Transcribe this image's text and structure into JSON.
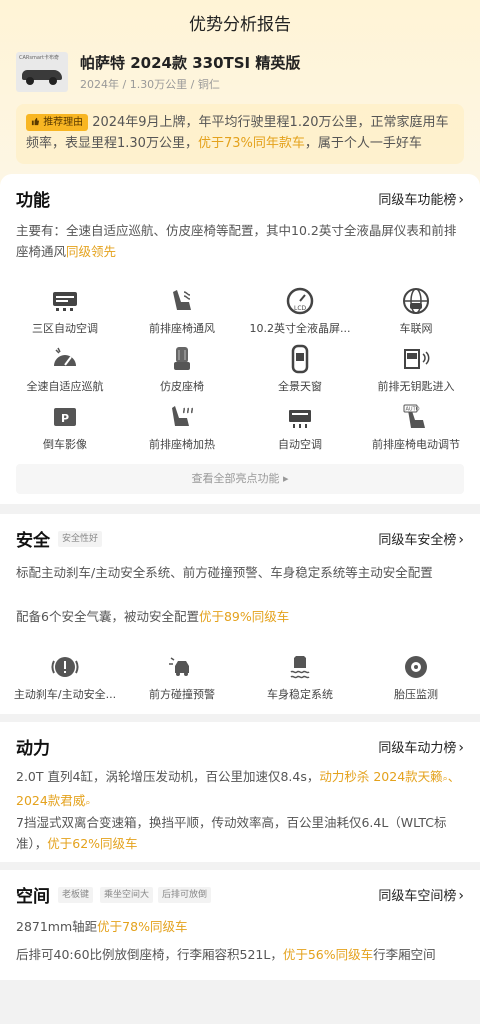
{
  "page": {
    "title": "优势分析报告"
  },
  "car": {
    "thumb_brand": "CARsmart卡布奇",
    "name": "帕萨特 2024款 330TSI 精英版",
    "meta": "2024年 / 1.30万公里 / 铜仁"
  },
  "reason": {
    "tag": "推荐理由",
    "text_a": "2024年9月上牌，年平均行驶里程1.20万公里，正常家庭用车频率，表显里程1.30万公里，",
    "highlight": "优于73%同年款车",
    "text_b": "，属于个人一手好车"
  },
  "function": {
    "title": "功能",
    "rank": "同级车功能榜",
    "desc_a": "主要有：全速自适应巡航、仿皮座椅等配置，其中10.2英寸全液晶屏仪表和前排座椅通风",
    "desc_hl": "同级领先",
    "features": [
      {
        "label": "三区自动空调",
        "icon": "ac-icon"
      },
      {
        "label": "前排座椅通风",
        "icon": "seat-vent-icon"
      },
      {
        "label": "10.2英寸全液晶屏...",
        "icon": "lcd-gauge-icon"
      },
      {
        "label": "车联网",
        "icon": "connected-car-icon"
      },
      {
        "label": "全速自适应巡航",
        "icon": "cruise-icon"
      },
      {
        "label": "仿皮座椅",
        "icon": "leather-seat-icon"
      },
      {
        "label": "全景天窗",
        "icon": "sunroof-icon"
      },
      {
        "label": "前排无钥匙进入",
        "icon": "keyless-icon"
      },
      {
        "label": "倒车影像",
        "icon": "reverse-camera-icon"
      },
      {
        "label": "前排座椅加热",
        "icon": "seat-heat-icon"
      },
      {
        "label": "自动空调",
        "icon": "auto-ac-icon"
      },
      {
        "label": "前排座椅电动调节",
        "icon": "seat-adjust-icon"
      }
    ],
    "view_all": "查看全部亮点功能 ▸"
  },
  "safety": {
    "title": "安全",
    "tag": "安全性好",
    "rank": "同级车安全榜",
    "desc1": "标配主动刹车/主动安全系统、前方碰撞预警、车身稳定系统等主动安全配置",
    "desc2_a": "配备6个安全气囊，被动安全配置",
    "desc2_hl": "优于89%同级车",
    "features": [
      {
        "label": "主动刹车/主动安全...",
        "icon": "brake-icon"
      },
      {
        "label": "前方碰撞预警",
        "icon": "collision-icon"
      },
      {
        "label": "车身稳定系统",
        "icon": "stability-icon"
      },
      {
        "label": "胎压监测",
        "icon": "tire-pressure-icon"
      }
    ]
  },
  "power": {
    "title": "动力",
    "rank": "同级车动力榜",
    "desc1_a": "2.0T 直列4缸，涡轮增压发动机，百公里加速仅8.4s，",
    "desc1_hl": "动力秒杀",
    "desc1_link1": "2024款天籁",
    "desc1_sep": "、",
    "desc1_link2": "2024款君威",
    "desc2_a": "7挡湿式双离合变速箱，换挡平顺，传动效率高，百公里油耗仅6.4L（WLTC标准），",
    "desc2_hl": "优于62%同级车"
  },
  "space": {
    "title": "空间",
    "tags": [
      "老板键",
      "乘坐空间大",
      "后排可放倒"
    ],
    "rank": "同级车空间榜",
    "desc1_a": "2871mm轴距",
    "desc1_hl": "优于78%同级车",
    "desc2_a": "后排可40:60比例放倒座椅，行李厢容积521L，",
    "desc2_hl": "优于56%同级车",
    "desc2_b": "行李厢空间"
  },
  "colors": {
    "accent": "#e4a21d",
    "tag_bg": "#f8b623"
  }
}
